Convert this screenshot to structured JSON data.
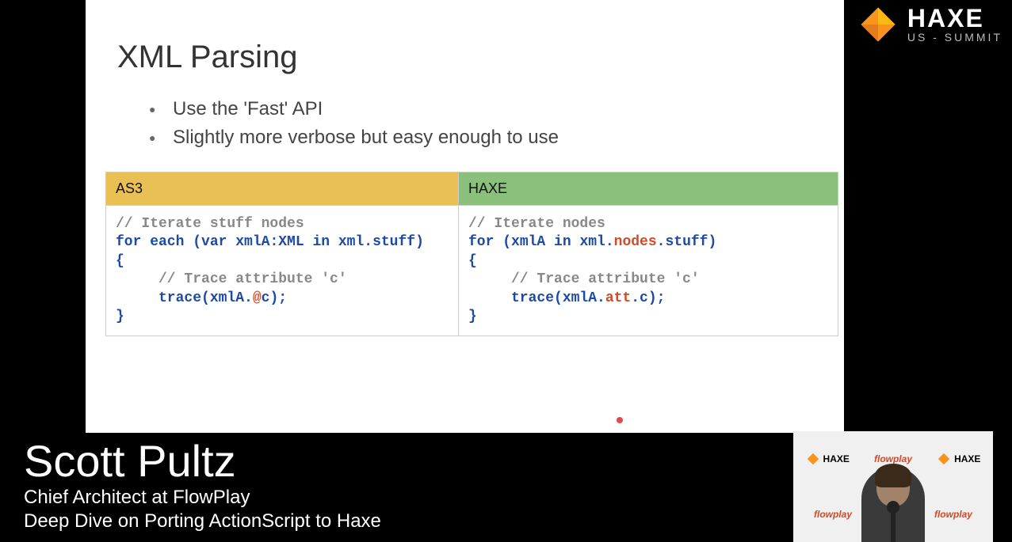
{
  "slide": {
    "title": "XML Parsing",
    "bullets": [
      "Use the 'Fast' API",
      "Slightly more verbose but easy enough to use"
    ],
    "columns": {
      "left_header": "AS3",
      "right_header": "HAXE"
    },
    "code_as3": {
      "line1_comment": "// Iterate stuff nodes",
      "line2_a": "for each ",
      "line2_b": "(",
      "line2_c": "var ",
      "line2_d": "xmlA:XML ",
      "line2_e": "in ",
      "line2_f": "xml.stuff)",
      "line3": "{",
      "line4_comment": "     // Trace attribute 'c'",
      "line5_a": "     trace(xmlA.",
      "line5_b": "@",
      "line5_c": "c);",
      "line6": "}"
    },
    "code_haxe": {
      "line1_comment": "// Iterate nodes",
      "line2_a": "for ",
      "line2_b": "(xmlA ",
      "line2_c": "in ",
      "line2_d": "xml.",
      "line2_e": "nodes",
      "line2_f": ".stuff)",
      "line3": "{",
      "line4_comment": "     // Trace attribute 'c'",
      "line5_a": "     trace(xmlA.",
      "line5_b": "att",
      "line5_c": ".c);",
      "line6": "}"
    }
  },
  "branding": {
    "logo_text_big": "HAXE",
    "logo_text_small": "US - SUMMIT"
  },
  "lower_third": {
    "name": "Scott Pultz",
    "role": "Chief Architect at FlowPlay",
    "talk": "Deep Dive on Porting ActionScript to Haxe"
  },
  "webcam": {
    "mini_haxe": "HAXE",
    "mini_flowplay": "flowplay"
  }
}
